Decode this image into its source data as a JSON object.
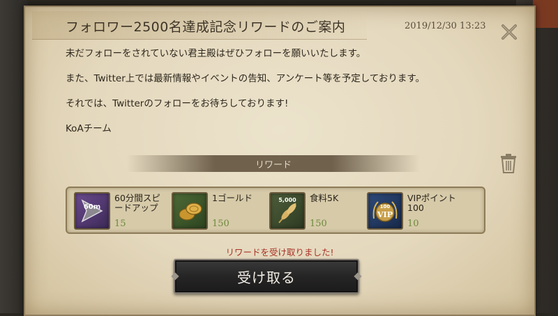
{
  "dialog": {
    "title": "フォロワー2500名達成記念リワードのご案内",
    "date": "2019/12/30 13:23",
    "body_lines": [
      "未だフォローをされていない君主殿はぜひフォローを願いいたします。",
      "また、Twitter上では最新情報やイベントの告知、アンケート等を予定しております。",
      "それでは、Twitterのフォローをお待ちしております!",
      "KoAチーム"
    ],
    "section_label": "リワード",
    "rewards": [
      {
        "name": "60分間スピードアップ",
        "qty": "15",
        "icon": "speedup-60m-icon",
        "badge": "60m"
      },
      {
        "name": "1ゴールド",
        "qty": "150",
        "icon": "gold-coins-icon"
      },
      {
        "name": "食料5K",
        "qty": "150",
        "icon": "wheat-food-icon",
        "badge": "5,000"
      },
      {
        "name": "VIPポイント100",
        "qty": "10",
        "icon": "vip-points-icon",
        "badge": "100",
        "badge2": "VIP"
      }
    ],
    "status_message": "リワードを受け取りました!",
    "receive_button": "受け取る"
  },
  "colors": {
    "parchment": "#e4d8bd",
    "quantity_green": "#6d8a3a",
    "status_red": "#a83226",
    "button_dark": "#262525"
  }
}
